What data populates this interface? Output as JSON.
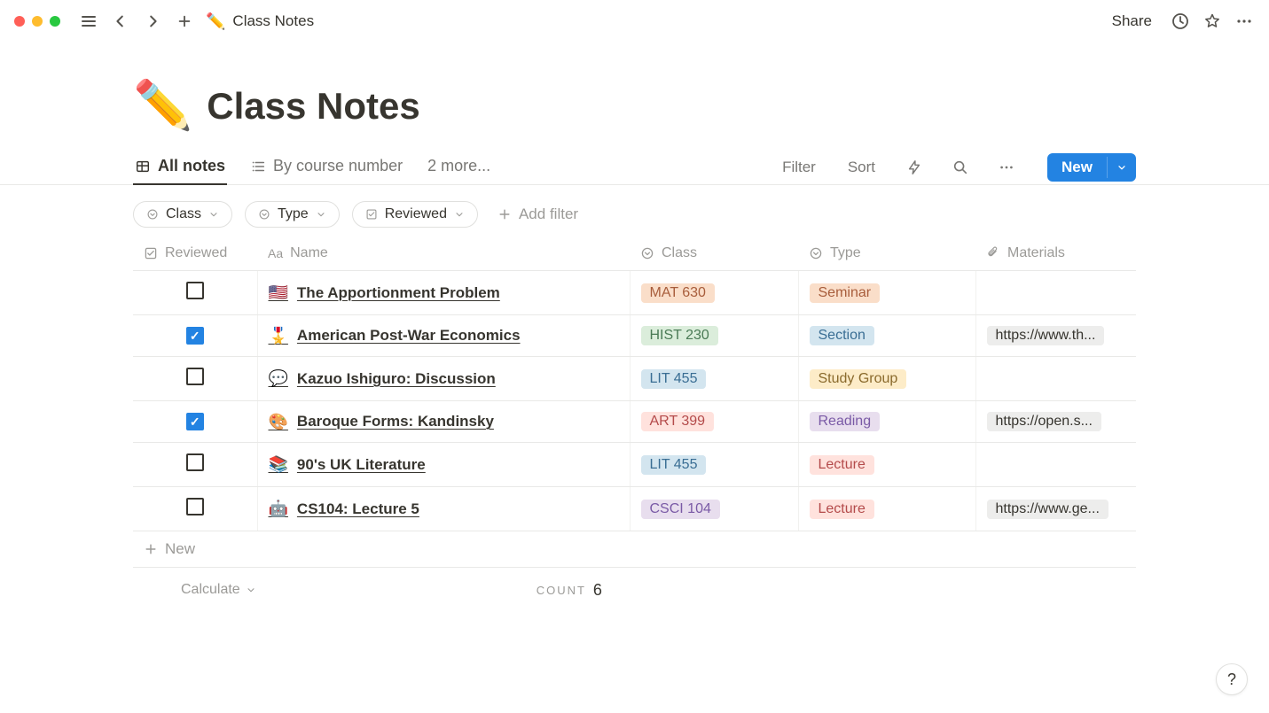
{
  "topbar": {
    "breadcrumb_icon": "✏️",
    "breadcrumb_title": "Class Notes",
    "share_label": "Share"
  },
  "page": {
    "icon": "✏️",
    "title": "Class Notes"
  },
  "views": {
    "tabs": [
      {
        "label": "All notes",
        "icon": "table"
      },
      {
        "label": "By course number",
        "icon": "list"
      },
      {
        "label": "2 more...",
        "icon": ""
      }
    ],
    "filter_label": "Filter",
    "sort_label": "Sort",
    "new_label": "New"
  },
  "filters": {
    "pills": [
      {
        "label": "Class",
        "icon": "select"
      },
      {
        "label": "Type",
        "icon": "select"
      },
      {
        "label": "Reviewed",
        "icon": "checkbox"
      }
    ],
    "add_label": "Add filter"
  },
  "table": {
    "columns": {
      "reviewed": "Reviewed",
      "name": "Name",
      "class": "Class",
      "type": "Type",
      "materials": "Materials"
    },
    "rows": [
      {
        "reviewed": false,
        "emoji": "🇺🇸",
        "name": "The Apportionment Problem",
        "class": {
          "label": "MAT 630",
          "bg": "#fadec9",
          "fg": "#a85d3b"
        },
        "type": {
          "label": "Seminar",
          "bg": "#fadec9",
          "fg": "#a85d3b"
        },
        "materials": ""
      },
      {
        "reviewed": true,
        "emoji": "🎖️",
        "name": "American Post-War Economics",
        "class": {
          "label": "HIST 230",
          "bg": "#dbeddb",
          "fg": "#4a7a55"
        },
        "type": {
          "label": "Section",
          "bg": "#d3e5ef",
          "fg": "#3a6e94"
        },
        "materials": "https://www.th..."
      },
      {
        "reviewed": false,
        "emoji": "💬",
        "name": "Kazuo Ishiguro: Discussion",
        "class": {
          "label": "LIT 455",
          "bg": "#d3e5ef",
          "fg": "#3a6e94"
        },
        "type": {
          "label": "Study Group",
          "bg": "#fdecc8",
          "fg": "#8a6a2c"
        },
        "materials": ""
      },
      {
        "reviewed": true,
        "emoji": "🎨",
        "name": "Baroque Forms: Kandinsky",
        "class": {
          "label": "ART 399",
          "bg": "#ffe2dd",
          "fg": "#b44b4b"
        },
        "type": {
          "label": "Reading",
          "bg": "#e8deee",
          "fg": "#7a5aa6"
        },
        "materials": "https://open.s..."
      },
      {
        "reviewed": false,
        "emoji": "📚",
        "name": "90's UK Literature",
        "class": {
          "label": "LIT 455",
          "bg": "#d3e5ef",
          "fg": "#3a6e94"
        },
        "type": {
          "label": "Lecture",
          "bg": "#ffe2dd",
          "fg": "#b44b4b"
        },
        "materials": ""
      },
      {
        "reviewed": false,
        "emoji": "🤖",
        "name": "CS104: Lecture 5",
        "class": {
          "label": "CSCI 104",
          "bg": "#e8deee",
          "fg": "#7a5aa6"
        },
        "type": {
          "label": "Lecture",
          "bg": "#ffe2dd",
          "fg": "#b44b4b"
        },
        "materials": "https://www.ge..."
      }
    ],
    "new_row_label": "New",
    "calculate_label": "Calculate",
    "count_label": "COUNT",
    "count_value": "6"
  },
  "help_label": "?"
}
